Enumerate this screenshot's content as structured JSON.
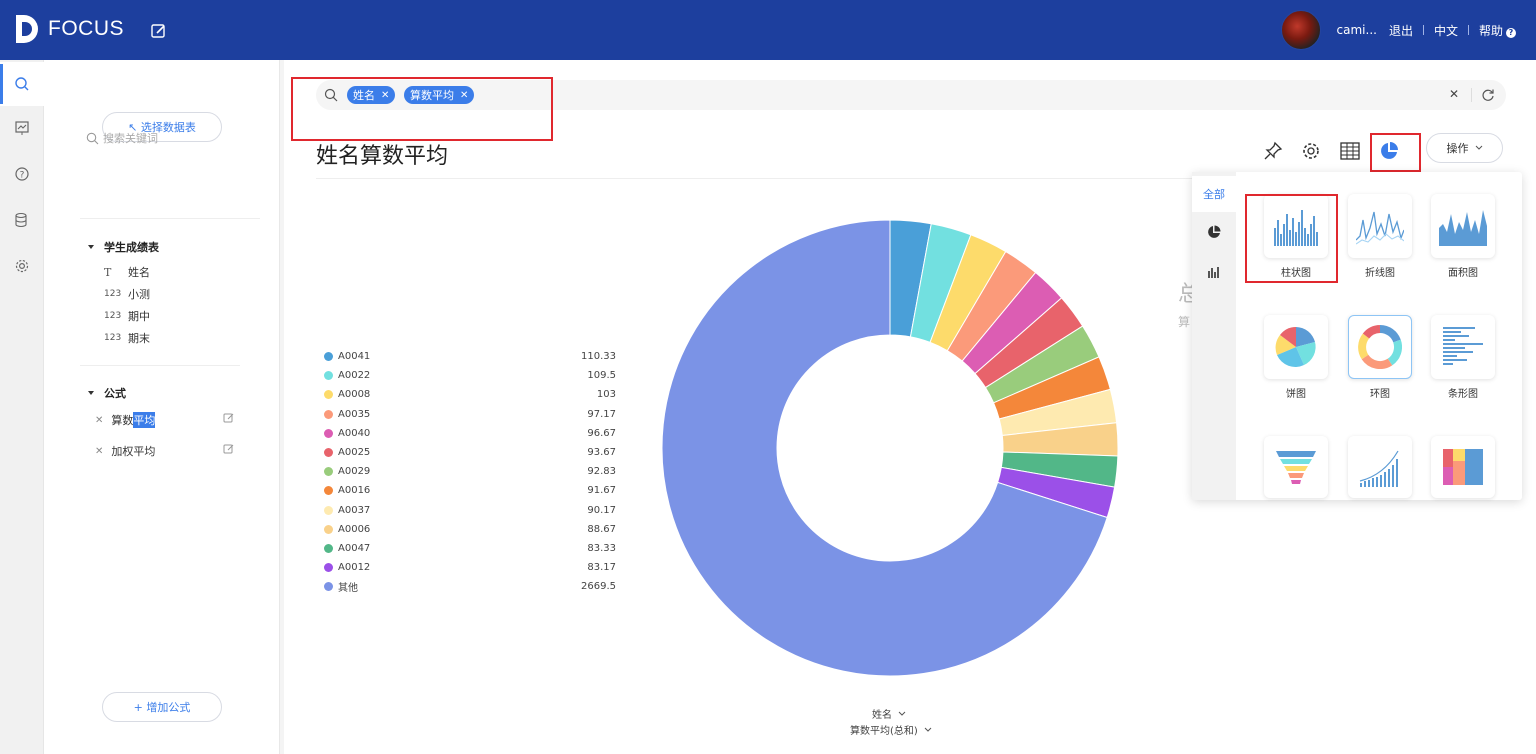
{
  "app": {
    "logo_text": "FOCUS"
  },
  "topbar": {
    "user": "cami...",
    "logout": "退出",
    "language": "中文",
    "help": "帮助"
  },
  "leftpanel": {
    "select_table_btn": "↖ 选择数据表",
    "search_placeholder": "搜索关键词",
    "table_name": "学生成绩表",
    "fields": [
      {
        "type": "T",
        "name": "姓名"
      },
      {
        "type": "123",
        "name": "小测"
      },
      {
        "type": "123",
        "name": "期中"
      },
      {
        "type": "123",
        "name": "期末"
      }
    ],
    "formula_group": "公式",
    "formulas": [
      {
        "prefix": "算数",
        "selected": "平均",
        "name": "算数平均"
      },
      {
        "name": "加权平均"
      }
    ],
    "add_formula_btn": "+ 增加公式"
  },
  "search": {
    "tags": [
      "姓名",
      "算数平均"
    ]
  },
  "page_title": "姓名算数平均",
  "toolbar": {
    "operations": "操作"
  },
  "side_partial": {
    "big": "总",
    "small": "算"
  },
  "axis": {
    "dim": "姓名",
    "measure": "算数平均(总和)"
  },
  "popover": {
    "tab_all": "全部",
    "chart_types": [
      "柱状图",
      "折线图",
      "面积图",
      "饼图",
      "环图",
      "条形图",
      "",
      "",
      ""
    ]
  },
  "colors": {
    "brand": "#1d3f9e",
    "accent": "#3b7de9",
    "highlight_red": "#e0282e"
  },
  "chart_data": {
    "type": "pie",
    "variant": "donut",
    "categories": [
      "A0041",
      "A0022",
      "A0008",
      "A0035",
      "A0040",
      "A0025",
      "A0029",
      "A0016",
      "A0037",
      "A0006",
      "A0047",
      "A0012",
      "其他"
    ],
    "values": [
      110.33,
      109.5,
      103,
      97.17,
      96.67,
      93.67,
      92.83,
      91.67,
      90.17,
      88.67,
      83.33,
      83.17,
      2669.5
    ],
    "value_labels": [
      "110.33",
      "109.5",
      "103",
      "97.17",
      "96.67",
      "93.67",
      "92.83",
      "91.67",
      "90.17",
      "88.67",
      "83.33",
      "83.17",
      "2669.5"
    ],
    "colors": [
      "#4a9fd8",
      "#72e0e0",
      "#fddb6b",
      "#fb9a7a",
      "#dc5db3",
      "#e8636b",
      "#99cc7c",
      "#f4873a",
      "#feeab0",
      "#f9d18a",
      "#52b788",
      "#9b50e8",
      "#7b93e6"
    ],
    "legend_position": "left"
  }
}
